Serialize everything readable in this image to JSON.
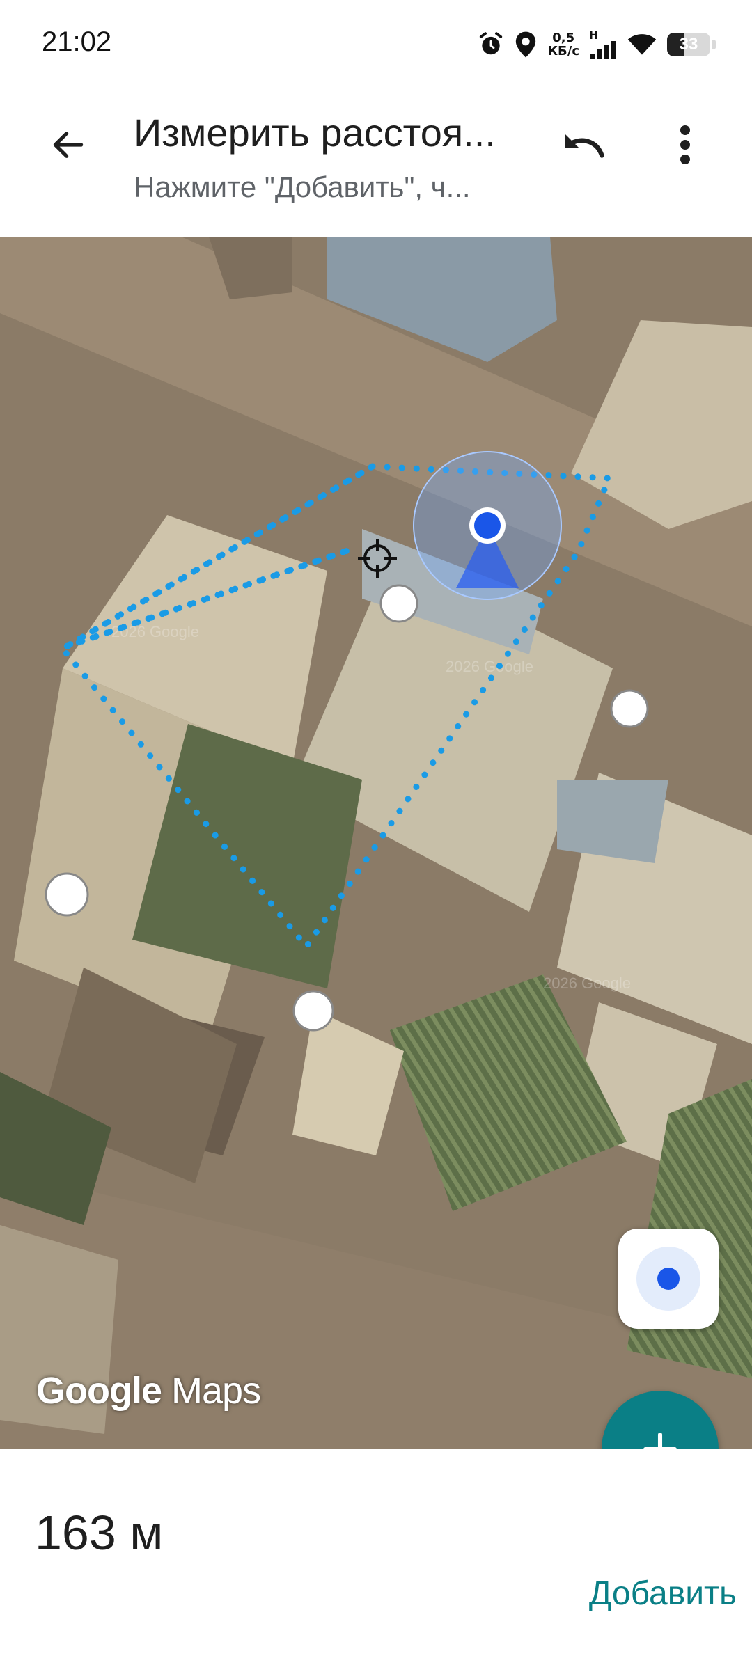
{
  "status_bar": {
    "time": "21:02",
    "net_speed_value": "0,5",
    "net_speed_unit": "КБ/с",
    "network_type": "H",
    "battery_level": "33",
    "icons": [
      "alarm-icon",
      "location-icon",
      "signal-icon",
      "wifi-icon",
      "battery-icon"
    ]
  },
  "toolbar": {
    "back_icon": "arrow-back-icon",
    "title": "Измерить расстоя...",
    "subtitle": "Нажмите \"Добавить\", ч...",
    "undo_icon": "undo-icon",
    "more_icon": "more-vert-icon"
  },
  "map": {
    "watermark_google": "Google",
    "watermark_maps": "Maps",
    "locate_icon": "my-location-icon",
    "add_point_icon": "plus-icon",
    "measure_line_color": "#1a9be6",
    "location_dot_color": "#1a56e8"
  },
  "bottom": {
    "distance": "163 м",
    "add_label": "Добавить"
  },
  "colors": {
    "accent": "#0a7f86",
    "subtitle": "#5f6368"
  }
}
